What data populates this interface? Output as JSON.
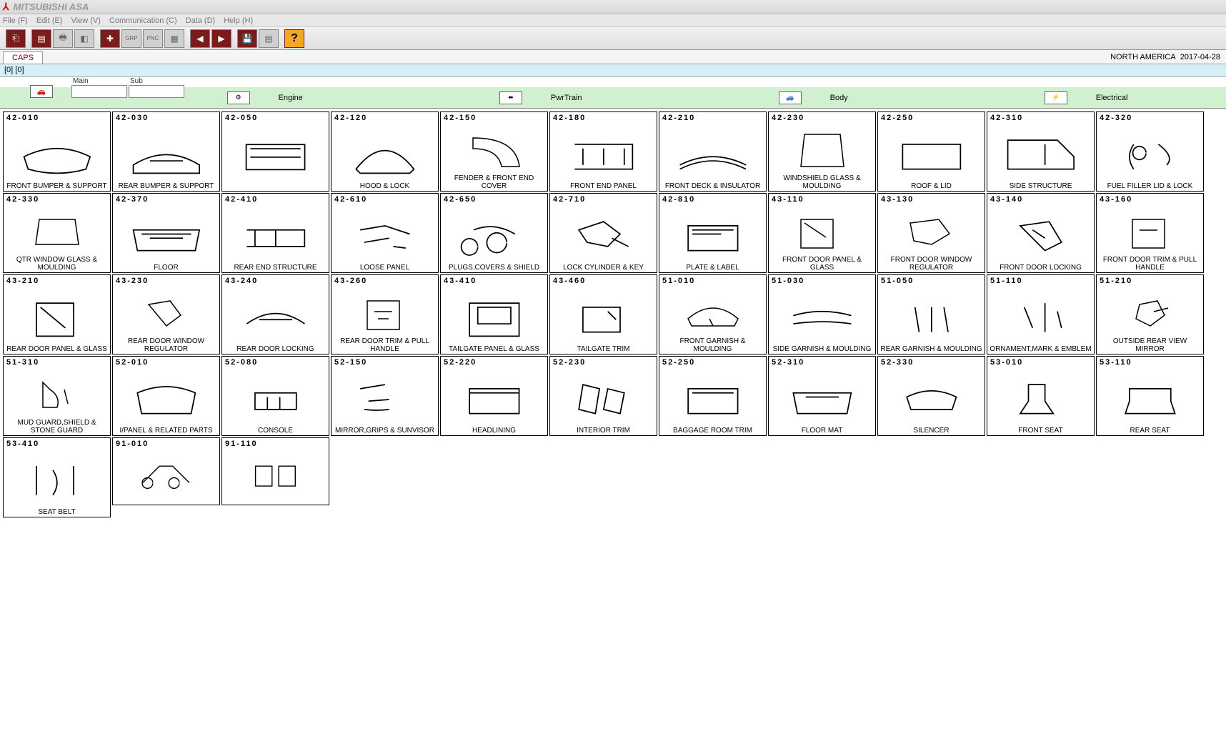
{
  "title": "MITSUBISHI ASA",
  "menus": [
    "File (F)",
    "Edit (E)",
    "View (V)",
    "Communication (C)",
    "Data (D)",
    "Help (H)"
  ],
  "tab": "CAPS",
  "region": "NORTH AMERICA",
  "date": "2017-04-28",
  "info": "[0] [0]",
  "mainsub": {
    "main_label": "Main",
    "sub_label": "Sub",
    "main": "",
    "sub": ""
  },
  "categories": [
    {
      "label": "Engine"
    },
    {
      "label": "PwrTrain"
    },
    {
      "label": "Body"
    },
    {
      "label": "Electrical"
    }
  ],
  "parts": [
    {
      "code": "42-010",
      "label": "FRONT BUMPER & SUPPORT"
    },
    {
      "code": "42-030",
      "label": "REAR BUMPER & SUPPORT"
    },
    {
      "code": "42-050",
      "label": ""
    },
    {
      "code": "42-120",
      "label": "HOOD & LOCK"
    },
    {
      "code": "42-150",
      "label": "FENDER & FRONT END COVER"
    },
    {
      "code": "42-180",
      "label": "FRONT END PANEL"
    },
    {
      "code": "42-210",
      "label": "FRONT DECK & INSULATOR"
    },
    {
      "code": "42-230",
      "label": "WINDSHIELD GLASS & MOULDING"
    },
    {
      "code": "42-250",
      "label": "ROOF & LID"
    },
    {
      "code": "42-310",
      "label": "SIDE STRUCTURE"
    },
    {
      "code": "42-320",
      "label": "FUEL FILLER LID & LOCK"
    },
    {
      "code": "42-330",
      "label": "QTR WINDOW GLASS & MOULDING"
    },
    {
      "code": "42-370",
      "label": "FLOOR"
    },
    {
      "code": "42-410",
      "label": "REAR END STRUCTURE"
    },
    {
      "code": "42-610",
      "label": "LOOSE PANEL"
    },
    {
      "code": "42-650",
      "label": "PLUGS,COVERS & SHIELD"
    },
    {
      "code": "42-710",
      "label": "LOCK CYLINDER & KEY"
    },
    {
      "code": "42-810",
      "label": "PLATE & LABEL"
    },
    {
      "code": "43-110",
      "label": "FRONT DOOR PANEL & GLASS"
    },
    {
      "code": "43-130",
      "label": "FRONT DOOR WINDOW REGULATOR"
    },
    {
      "code": "43-140",
      "label": "FRONT DOOR LOCKING"
    },
    {
      "code": "43-160",
      "label": "FRONT DOOR TRIM & PULL HANDLE"
    },
    {
      "code": "43-210",
      "label": "REAR DOOR PANEL & GLASS"
    },
    {
      "code": "43-230",
      "label": "REAR DOOR WINDOW REGULATOR"
    },
    {
      "code": "43-240",
      "label": "REAR DOOR LOCKING"
    },
    {
      "code": "43-260",
      "label": "REAR DOOR TRIM & PULL HANDLE"
    },
    {
      "code": "43-410",
      "label": "TAILGATE PANEL & GLASS"
    },
    {
      "code": "43-460",
      "label": "TAILGATE TRIM"
    },
    {
      "code": "51-010",
      "label": "FRONT GARNISH & MOULDING"
    },
    {
      "code": "51-030",
      "label": "SIDE GARNISH & MOULDING"
    },
    {
      "code": "51-050",
      "label": "REAR GARNISH & MOULDING"
    },
    {
      "code": "51-110",
      "label": "ORNAMENT,MARK & EMBLEM"
    },
    {
      "code": "51-210",
      "label": "OUTSIDE REAR VIEW MIRROR"
    },
    {
      "code": "51-310",
      "label": "MUD GUARD,SHIELD & STONE GUARD"
    },
    {
      "code": "52-010",
      "label": "I/PANEL & RELATED PARTS"
    },
    {
      "code": "52-080",
      "label": "CONSOLE"
    },
    {
      "code": "52-150",
      "label": "MIRROR,GRIPS & SUNVISOR"
    },
    {
      "code": "52-220",
      "label": "HEADLINING"
    },
    {
      "code": "52-230",
      "label": "INTERIOR TRIM"
    },
    {
      "code": "52-250",
      "label": "BAGGAGE ROOM TRIM"
    },
    {
      "code": "52-310",
      "label": "FLOOR MAT"
    },
    {
      "code": "52-330",
      "label": "SILENCER"
    },
    {
      "code": "53-010",
      "label": "FRONT SEAT"
    },
    {
      "code": "53-110",
      "label": "REAR SEAT"
    },
    {
      "code": "53-410",
      "label": "SEAT BELT"
    },
    {
      "code": "91-010",
      "label": ""
    },
    {
      "code": "91-110",
      "label": ""
    }
  ]
}
